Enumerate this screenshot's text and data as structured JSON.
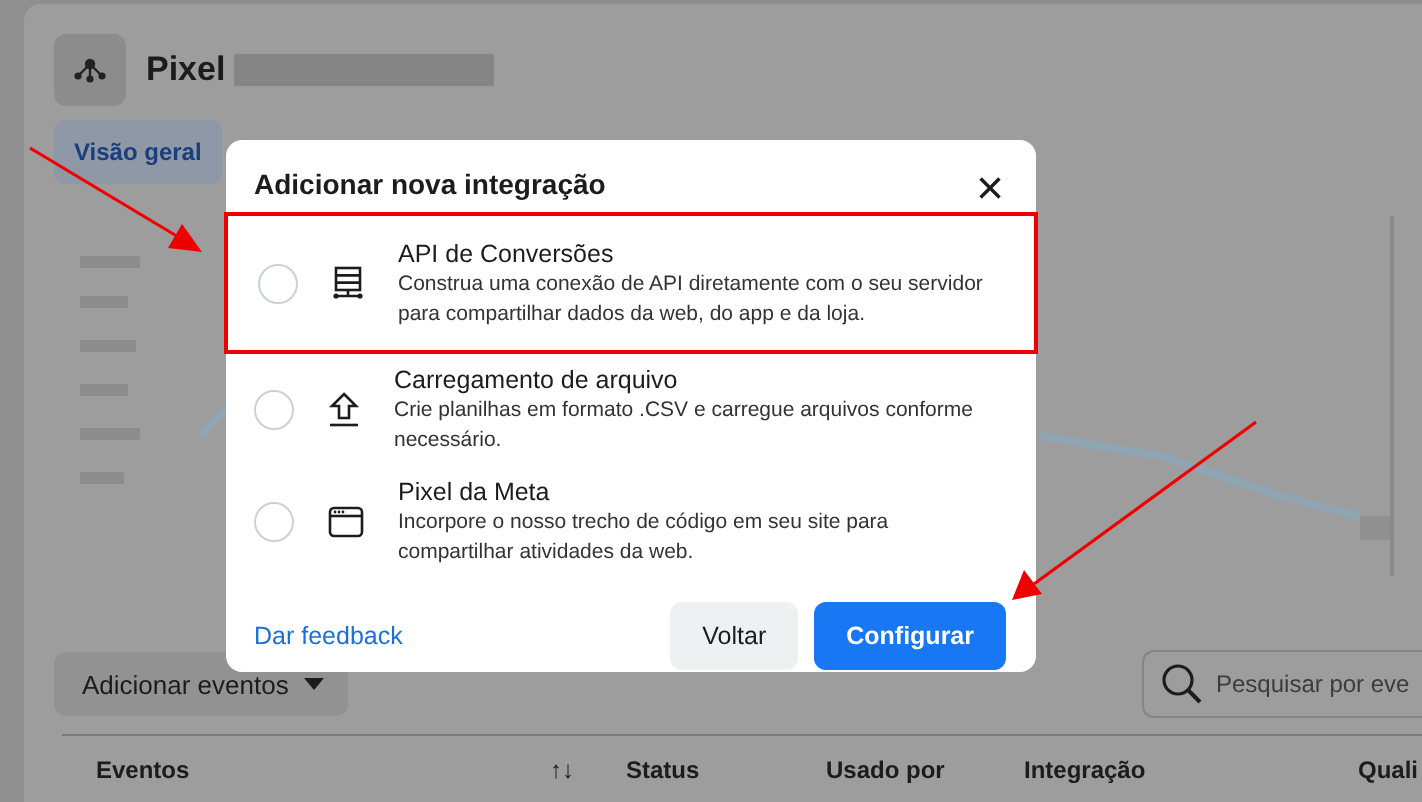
{
  "page": {
    "title": "Pixel",
    "tabs": [
      {
        "label": "Visão geral",
        "selected": true
      }
    ],
    "add_events_button": "Adicionar eventos",
    "search": {
      "placeholder": "Pesquisar por eve"
    },
    "table": {
      "columns": [
        {
          "label": "Eventos",
          "sort": "↑↓"
        },
        {
          "label": "Status"
        },
        {
          "label": "Usado por"
        },
        {
          "label": "Integração"
        },
        {
          "label": "Quali"
        }
      ]
    }
  },
  "dialog": {
    "title": "Adicionar nova integração",
    "close": "×",
    "options": [
      {
        "kind": "server",
        "title": "API de Conversões",
        "description": "Construa uma conexão de API diretamente com o seu servidor para compartilhar dados da web, do app e da loja.",
        "selected": false,
        "highlighted": true
      },
      {
        "kind": "upload",
        "title": "Carregamento de arquivo",
        "description": "Crie planilhas em formato .CSV e carregue arquivos conforme necessário.",
        "selected": false,
        "highlighted": false
      },
      {
        "kind": "browser",
        "title": "Pixel da Meta",
        "description": "Incorpore o nosso trecho de código em seu site para compartilhar atividades da web.",
        "selected": false,
        "highlighted": false
      }
    ],
    "feedback_link": "Dar feedback",
    "buttons": [
      {
        "label": "Voltar",
        "kind": "secondary"
      },
      {
        "label": "Configurar",
        "kind": "primary"
      }
    ]
  }
}
